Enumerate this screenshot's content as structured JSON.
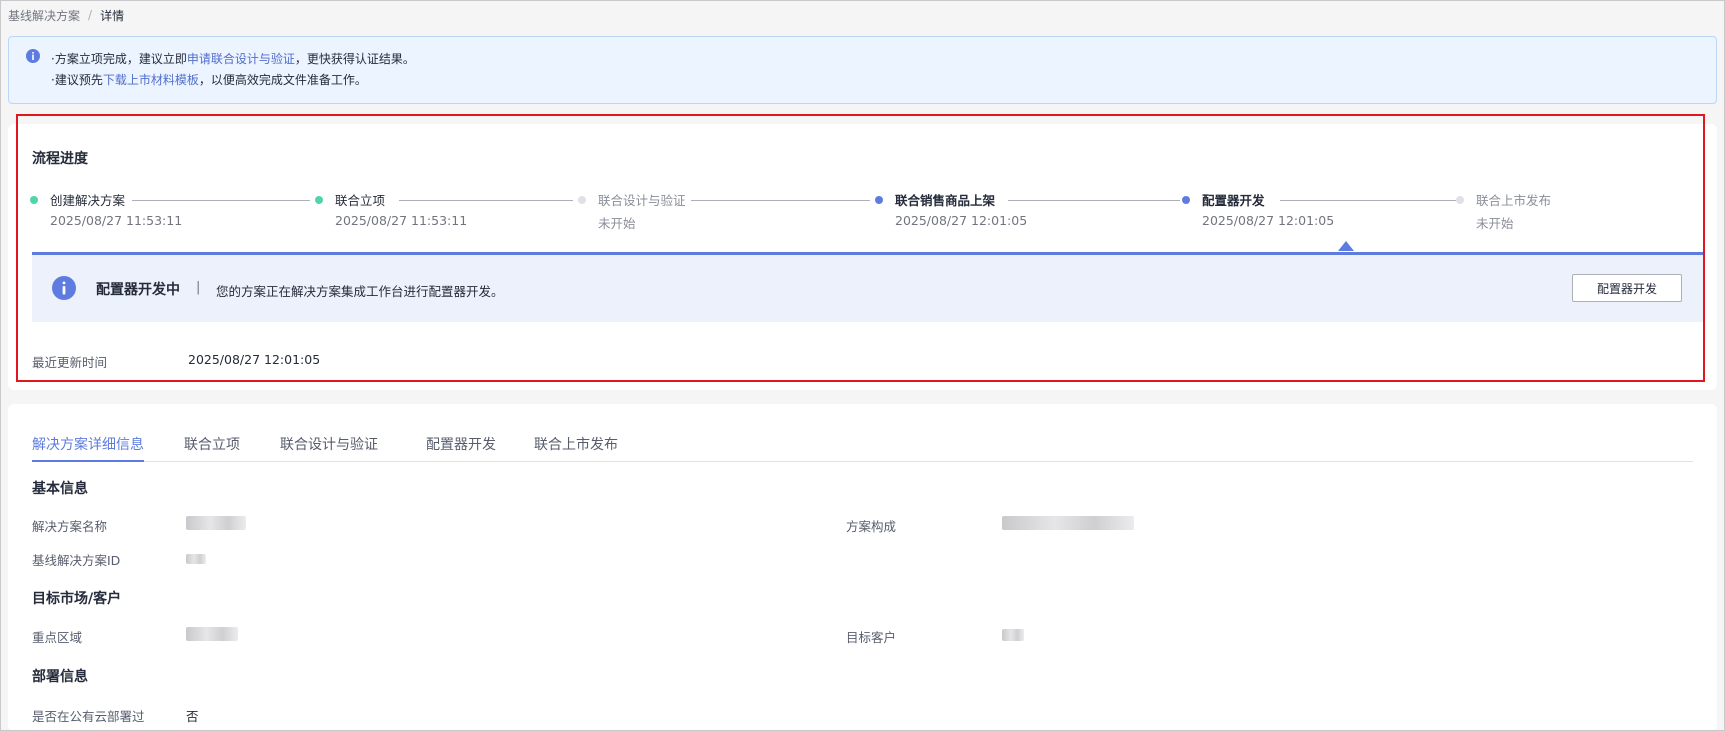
{
  "breadcrumb": {
    "parent": "基线解决方案",
    "separator": "/",
    "current": "详情"
  },
  "notice": {
    "line1_prefix": "·方案立项完成，建议立即",
    "line1_link": "申请联合设计与验证",
    "line1_suffix": "，更快获得认证结果。",
    "line2_prefix": "·建议预先",
    "line2_link": "下载上市材料模板",
    "line2_suffix": "，以便高效完成文件准备工作。",
    "icon": "info-icon"
  },
  "progress": {
    "title": "流程进度",
    "steps": [
      {
        "name": "创建解决方案",
        "time": "2025/08/27 11:53:11",
        "state": "done"
      },
      {
        "name": "联合立项",
        "time": "2025/08/27 11:53:11",
        "state": "done"
      },
      {
        "name": "联合设计与验证",
        "time": "未开始",
        "state": "pending"
      },
      {
        "name": "联合销售商品上架",
        "time": "2025/08/27 12:01:05",
        "state": "active"
      },
      {
        "name": "配置器开发",
        "time": "2025/08/27 12:01:05",
        "state": "active"
      },
      {
        "name": "联合上市发布",
        "time": "未开始",
        "state": "pending"
      }
    ],
    "status": {
      "title": "配置器开发中",
      "divider": "|",
      "description": "您的方案正在解决方案集成工作台进行配置器开发。",
      "button": "配置器开发"
    },
    "update_label": "最近更新时间",
    "update_value": "2025/08/27 12:01:05"
  },
  "tabs": [
    "解决方案详细信息",
    "联合立项",
    "联合设计与验证",
    "配置器开发",
    "联合上市发布"
  ],
  "basic": {
    "title": "基本信息",
    "name_label": "解决方案名称",
    "composition_label": "方案构成",
    "id_label": "基线解决方案ID"
  },
  "market": {
    "title": "目标市场/客户",
    "region_label": "重点区域",
    "customer_label": "目标客户"
  },
  "deploy": {
    "title": "部署信息",
    "public_cloud_label": "是否在公有云部署过",
    "public_cloud_value": "否"
  },
  "colors": {
    "accent": "#5e7ce0",
    "done": "#50d4ab",
    "pending": "#dfe1e6",
    "highlight": "#e0171e",
    "link": "#526ecc"
  }
}
